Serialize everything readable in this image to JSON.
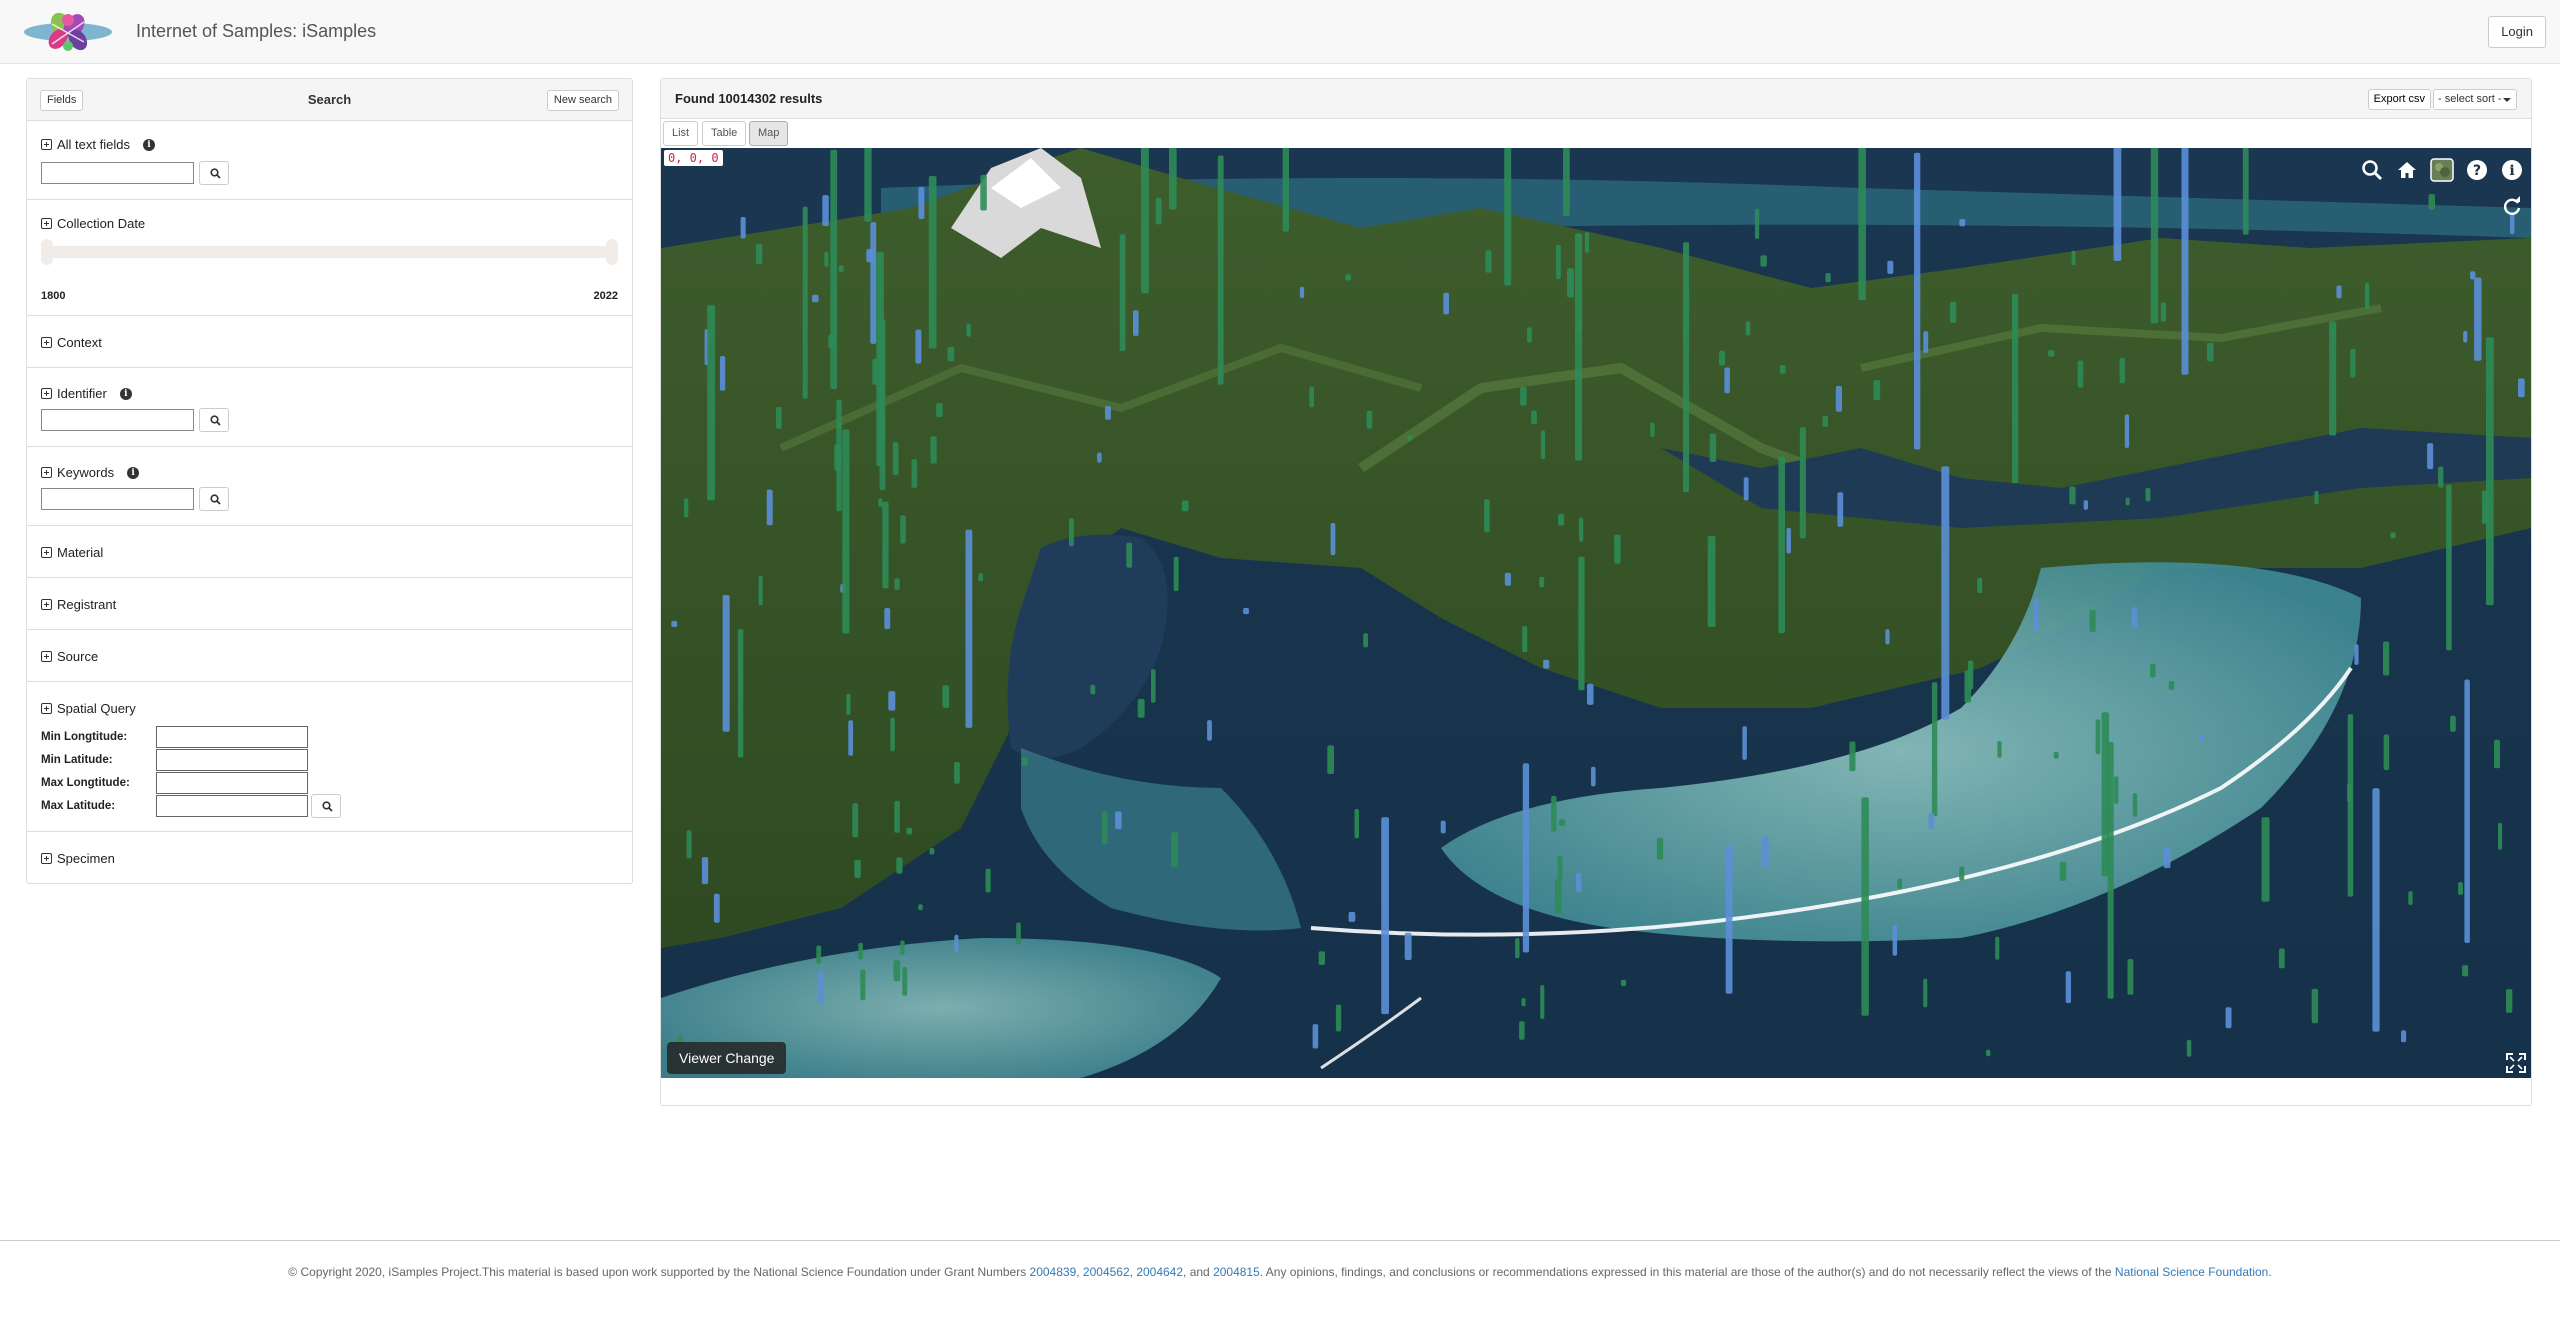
{
  "header": {
    "title": "Internet of Samples: iSamples",
    "login_label": "Login"
  },
  "search_panel": {
    "fields_label": "Fields",
    "title": "Search",
    "new_search_label": "New search",
    "facets": {
      "all_text": "All text fields",
      "collection_date": "Collection Date",
      "date_min": "1800",
      "date_max": "2022",
      "context": "Context",
      "identifier": "Identifier",
      "keywords": "Keywords",
      "material": "Material",
      "registrant": "Registrant",
      "source": "Source",
      "spatial_query": "Spatial Query",
      "specimen": "Specimen"
    },
    "spatial": {
      "min_lon": "Min Longtitude:",
      "min_lat": "Min Latitude:",
      "max_lon": "Max Longtitude:",
      "max_lat": "Max Latitude:"
    }
  },
  "results": {
    "found_text": "Found 10014302 results",
    "export_label": "Export csv",
    "sort_placeholder": "- select sort -",
    "tabs": [
      "List",
      "Table",
      "Map"
    ],
    "active_tab": "Map"
  },
  "map": {
    "coord_readout": "0, 0, 0",
    "viewer_change_label": "Viewer Change",
    "tools": [
      "search-icon",
      "home-icon",
      "layers-icon",
      "help-icon",
      "info-icon"
    ]
  },
  "footer": {
    "text_before": "© Copyright 2020, iSamples Project.This material is based upon work supported by the National Science Foundation under Grant Numbers ",
    "grant1": "2004839",
    "sep1": ", ",
    "grant2": "2004562",
    "sep2": ", ",
    "grant3": "2004642",
    "sep3": ", and ",
    "grant4": "2004815",
    "text_middle": ". Any opinions, findings, and conclusions or recommendations expressed in this material are those of the author(s) and do not necessarily reflect the views of the ",
    "nsf_link": "National Science Foundation",
    "text_end": "."
  },
  "colors": {
    "link": "#337ab7",
    "pillar_green": "#2e8b57",
    "pillar_blue": "#5b8fd8"
  }
}
